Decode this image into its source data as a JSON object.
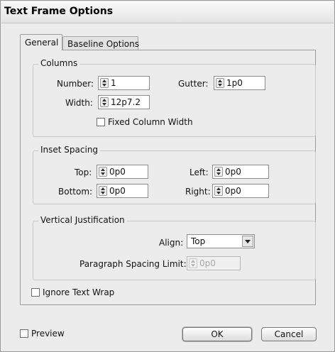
{
  "dialog": {
    "title": "Text Frame Options"
  },
  "tabs": [
    {
      "label": "General",
      "active": true
    },
    {
      "label": "Baseline Options",
      "active": false
    }
  ],
  "columns": {
    "title": "Columns",
    "number_label": "Number:",
    "number_value": "1",
    "gutter_label": "Gutter:",
    "gutter_value": "1p0",
    "width_label": "Width:",
    "width_value": "12p7.2",
    "fixed_width_label": "Fixed Column Width",
    "fixed_width_checked": false
  },
  "inset_spacing": {
    "title": "Inset Spacing",
    "top_label": "Top:",
    "top_value": "0p0",
    "bottom_label": "Bottom:",
    "bottom_value": "0p0",
    "left_label": "Left:",
    "left_value": "0p0",
    "right_label": "Right:",
    "right_value": "0p0"
  },
  "vertical_justification": {
    "title": "Vertical Justification",
    "align_label": "Align:",
    "align_value": "Top",
    "paragraph_spacing_label": "Paragraph Spacing Limit:",
    "paragraph_spacing_value": "0p0"
  },
  "ignore_text_wrap": {
    "label": "Ignore Text Wrap",
    "checked": false
  },
  "footer": {
    "preview_label": "Preview",
    "preview_checked": false,
    "ok_label": "OK",
    "cancel_label": "Cancel"
  }
}
